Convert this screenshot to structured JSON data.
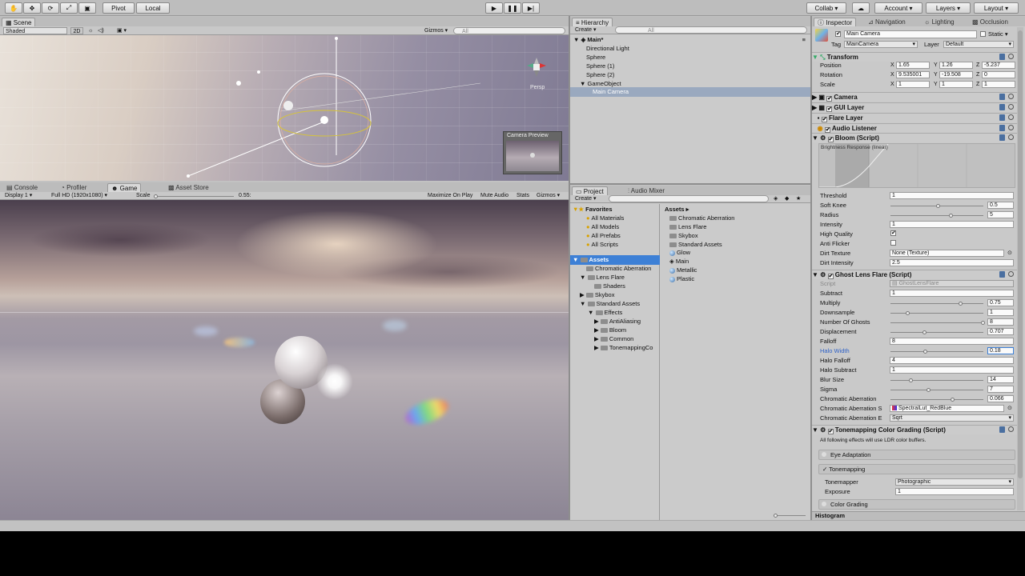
{
  "toolbar": {
    "pivot": "Pivot",
    "local": "Local",
    "collab": "Collab ▾",
    "account": "Account ▾",
    "layers": "Layers ▾",
    "layout": "Layout ▾"
  },
  "scene": {
    "tab": "Scene",
    "shading": "Shaded",
    "mode2d": "2D",
    "gizmos": "Gizmos ▾",
    "search_placeholder": "All",
    "persp": "Persp",
    "camera_preview": "Camera Preview"
  },
  "game": {
    "tabs": [
      "Console",
      "Profiler",
      "Game",
      "Asset Store"
    ],
    "display": "Display 1",
    "resolution": "Full HD (1920x1080)",
    "scale_label": "Scale",
    "scale_value": "0.55:",
    "maximize": "Maximize On Play",
    "mute": "Mute Audio",
    "stats": "Stats",
    "gizmos": "Gizmos ▾"
  },
  "hierarchy": {
    "tab": "Hierarchy",
    "create": "Create ▾",
    "search_placeholder": "All",
    "scene": "Main*",
    "items": [
      "Directional Light",
      "Sphere",
      "Sphere (1)",
      "Sphere (2)",
      "GameObject",
      "Main Camera"
    ]
  },
  "project": {
    "tabs": [
      "Project",
      "Audio Mixer"
    ],
    "create": "Create ▾",
    "favorites": "Favorites",
    "fav_items": [
      "All Materials",
      "All Models",
      "All Prefabs",
      "All Scripts"
    ],
    "assets_root": "Assets",
    "tree": [
      "Chromatic Aberration",
      "Lens Flare",
      "Shaders",
      "Skybox",
      "Standard Assets",
      "Effects",
      "AntiAliasing",
      "Bloom",
      "Common",
      "TonemappingCo"
    ],
    "breadcrumb": "Assets ▸",
    "assets": [
      "Chromatic Aberration",
      "Lens Flare",
      "Skybox",
      "Standard Assets",
      "Glow",
      "Main",
      "Metallic",
      "Plastic"
    ]
  },
  "inspector": {
    "tabs": [
      "Inspector",
      "Navigation",
      "Lighting",
      "Occlusion"
    ],
    "object_name": "Main Camera",
    "static": "Static ▾",
    "tag_label": "Tag",
    "tag": "MainCamera",
    "layer_label": "Layer",
    "layer": "Default",
    "transform": {
      "title": "Transform",
      "position": "Position",
      "rotation": "Rotation",
      "scale": "Scale",
      "pos": [
        "1.65",
        "1.26",
        "-5.237"
      ],
      "rot": [
        "9.535001",
        "-19.508",
        "0"
      ],
      "scl": [
        "1",
        "1",
        "1"
      ],
      "x": "X",
      "y": "Y",
      "z": "Z"
    },
    "components": [
      "Camera",
      "GUI Layer",
      "Flare Layer",
      "Audio Listener",
      "Bloom (Script)"
    ],
    "bloom": {
      "graph_label": "Brightness Response (linear)",
      "threshold": {
        "label": "Threshold",
        "value": "1"
      },
      "soft_knee": {
        "label": "Soft Knee",
        "value": "0.5",
        "level": 0.5
      },
      "radius": {
        "label": "Radius",
        "value": "5",
        "level": 0.65
      },
      "intensity": {
        "label": "Intensity",
        "value": "1"
      },
      "high_quality": {
        "label": "High Quality",
        "checked": "✔"
      },
      "anti_flicker": {
        "label": "Anti Flicker"
      },
      "dirt_texture": {
        "label": "Dirt Texture",
        "value": "None (Texture)"
      },
      "dirt_intensity": {
        "label": "Dirt Intensity",
        "value": "2.5"
      }
    },
    "ghost": {
      "title": "Ghost Lens Flare (Script)",
      "script_label": "Script",
      "script_value": "GhostLensFlare",
      "rows": [
        {
          "label": "Subtract",
          "value": "1"
        },
        {
          "label": "Multiply",
          "value": "0.75",
          "level": 0.75
        },
        {
          "label": "Downsample",
          "value": "1",
          "level": 0.17
        },
        {
          "label": "Number Of Ghosts",
          "value": "8",
          "level": 1.0
        },
        {
          "label": "Displacement",
          "value": "0.707",
          "level": 0.35
        },
        {
          "label": "Falloff",
          "value": "8"
        },
        {
          "label": "Halo Width",
          "value": "0.18",
          "level": 0.36
        },
        {
          "label": "Halo Falloff",
          "value": "4"
        },
        {
          "label": "Halo Subtract",
          "value": "1"
        },
        {
          "label": "Blur Size",
          "value": "14",
          "level": 0.2
        },
        {
          "label": "Sigma",
          "value": "7",
          "level": 0.4
        },
        {
          "label": "Chromatic Aberration",
          "value": "0.066",
          "level": 0.66
        }
      ],
      "ca_tex_label": "Chromatic Aberration S",
      "ca_tex_value": "SpectralLut_RedBlue",
      "ca_type_label": "Chromatic Aberration E",
      "ca_type_value": "Sqrt"
    },
    "tonemapping": {
      "title": "Tonemapping Color Grading (Script)",
      "note": "All following effects will use LDR color buffers.",
      "eye": "Eye Adaptation",
      "tonemapping": "✓ Tonemapping",
      "tonemapper_label": "Tonemapper",
      "tonemapper": "Photographic",
      "exposure_label": "Exposure",
      "exposure": "1",
      "color_grading": "Color Grading"
    },
    "histogram": "Histogram"
  }
}
